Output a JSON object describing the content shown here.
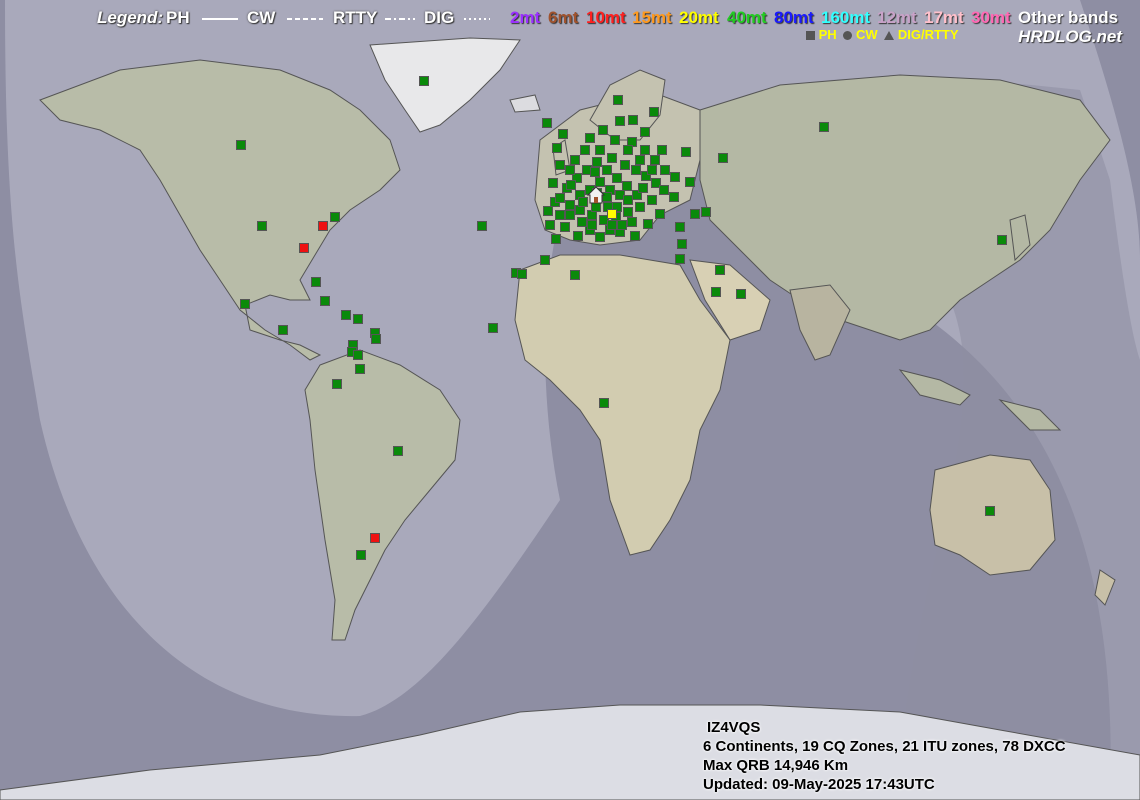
{
  "legend": {
    "title": "Legend:",
    "modes": [
      {
        "label": "PH",
        "line": "solid"
      },
      {
        "label": "CW",
        "line": "dashed"
      },
      {
        "label": "RTTY",
        "line": "dashdot"
      },
      {
        "label": "DIG",
        "line": "dotted"
      }
    ],
    "bands": [
      {
        "label": "2mt",
        "color": "#9b30ff"
      },
      {
        "label": "6mt",
        "color": "#a0522d"
      },
      {
        "label": "10mt",
        "color": "#ff2020"
      },
      {
        "label": "15mt",
        "color": "#ff9a1f"
      },
      {
        "label": "20mt",
        "color": "#ffff00"
      },
      {
        "label": "40mt",
        "color": "#22cc22"
      },
      {
        "label": "80mt",
        "color": "#1a1aff"
      },
      {
        "label": "160mt",
        "color": "#33ffff"
      },
      {
        "label": "12mt",
        "color": "#c8a2c8"
      },
      {
        "label": "17mt",
        "color": "#ffc0cb"
      },
      {
        "label": "30mt",
        "color": "#ff69b4"
      },
      {
        "label": "Other bands",
        "color": "#ffffff"
      }
    ],
    "mode_symbols": [
      {
        "label": "PH",
        "symbol": "square"
      },
      {
        "label": "CW",
        "symbol": "circle"
      },
      {
        "label": "DIG/RTTY",
        "symbol": "triangle"
      }
    ],
    "brand": "HRDLOG.net"
  },
  "station": {
    "callsign": "IZ4VQS",
    "summary": "6 Continents, 19 CQ Zones, 21 ITU zones, 78 DXCC",
    "max_qrb": "Max QRB 14,946 Km",
    "updated": "Updated: 09-May-2025 17:43UTC"
  },
  "colors": {
    "contact_40mt": "#0a8a0a",
    "contact_10mt": "#ee1111",
    "contact_20mt": "#ffff00",
    "night": "#8e8ea3",
    "day": "#aeaec0"
  }
}
